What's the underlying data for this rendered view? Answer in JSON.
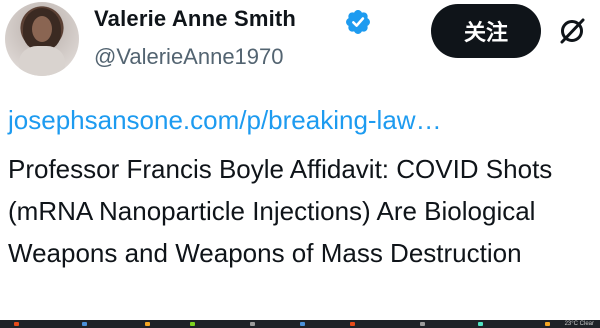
{
  "author": {
    "display_name": "Valerie Anne Smith",
    "handle": "@ValerieAnne1970",
    "verified": true,
    "avatar_icon": "profile-photo"
  },
  "actions": {
    "follow_label": "关注",
    "grok_icon": "slash-circle-icon"
  },
  "tweet": {
    "link_text": "josephsansone.com/p/breaking-law…",
    "body": "Professor Francis Boyle Affidavit: COVID Shots (mRNA Nanoparticle Injections) Are Biological Weapons and Weapons of Mass Destruction"
  },
  "taskbar": {
    "tray_text": "23°C  Clear"
  },
  "colors": {
    "link": "#1d9bf0",
    "text": "#0f1419",
    "secondary": "#536471",
    "verified": "#1d9bf0",
    "button_bg": "#0f1419"
  }
}
